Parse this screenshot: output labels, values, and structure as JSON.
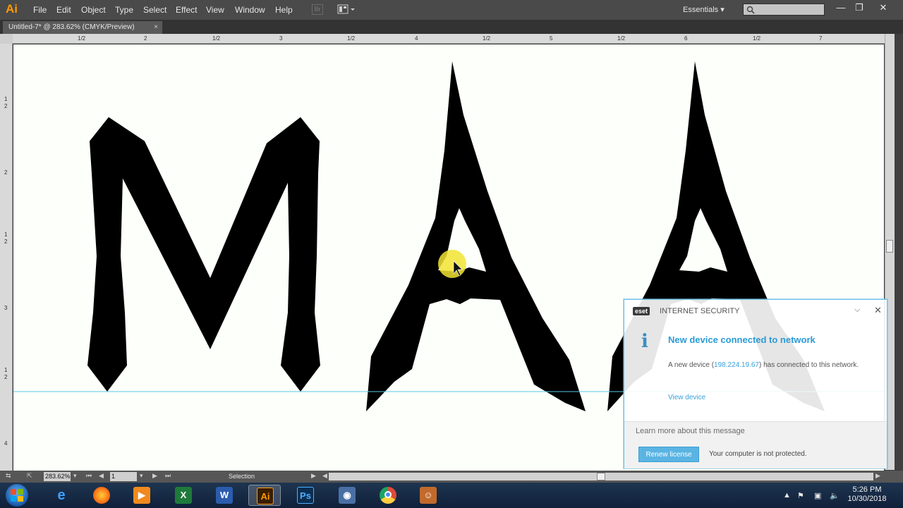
{
  "app": {
    "logo": "Ai",
    "menu": [
      "File",
      "Edit",
      "Object",
      "Type",
      "Select",
      "Effect",
      "View",
      "Window",
      "Help"
    ],
    "workspace": "Essentials",
    "window_controls": {
      "minimize": "—",
      "restore": "❐",
      "close": "✕"
    }
  },
  "document": {
    "tab_title": "Untitled-7* @ 283.62% (CMYK/Preview)",
    "tab_close": "×",
    "artwork_text": "MAA"
  },
  "rulers": {
    "top_labels": [
      "1/2",
      "2",
      "1/2",
      "3",
      "1/2",
      "4",
      "1/2",
      "5",
      "1/2",
      "6",
      "1/2",
      "7"
    ],
    "left_labels": [
      "1",
      "2",
      "2",
      "1",
      "2",
      "3",
      "1",
      "2",
      "4"
    ]
  },
  "statusbar": {
    "zoom": "283.62%",
    "page": "1",
    "tool": "Selection"
  },
  "eset": {
    "logo": "eset",
    "product": "INTERNET SECURITY",
    "heading": "New device connected to network",
    "body_prefix": "A new device (",
    "ip": "198.224.19.67",
    "body_suffix": ") has connected to this network.",
    "view_link": "View device",
    "learn_more": "Learn more about this message",
    "renew_button": "Renew license",
    "status": "Your computer is not protected."
  },
  "taskbar": {
    "apps": [
      {
        "name": "internet-explorer",
        "glyph": "e",
        "color": "#2e8fe0"
      },
      {
        "name": "firefox",
        "glyph": "",
        "color": "#ff7a1a"
      },
      {
        "name": "media-player",
        "glyph": "▶",
        "color": "#f08a1e"
      },
      {
        "name": "excel",
        "glyph": "X",
        "color": "#1f7a3a"
      },
      {
        "name": "word",
        "glyph": "W",
        "color": "#2b5cad"
      },
      {
        "name": "illustrator",
        "glyph": "Ai",
        "color": "#3b1e00"
      },
      {
        "name": "photoshop",
        "glyph": "Ps",
        "color": "#0c2e52"
      },
      {
        "name": "app-player",
        "glyph": "◉",
        "color": "#4a6fa5"
      },
      {
        "name": "chrome",
        "glyph": "",
        "color": "#dd4b39"
      },
      {
        "name": "photo-app",
        "glyph": "☺",
        "color": "#c26a2b"
      }
    ],
    "time": "5:26 PM",
    "date": "10/30/2018"
  }
}
